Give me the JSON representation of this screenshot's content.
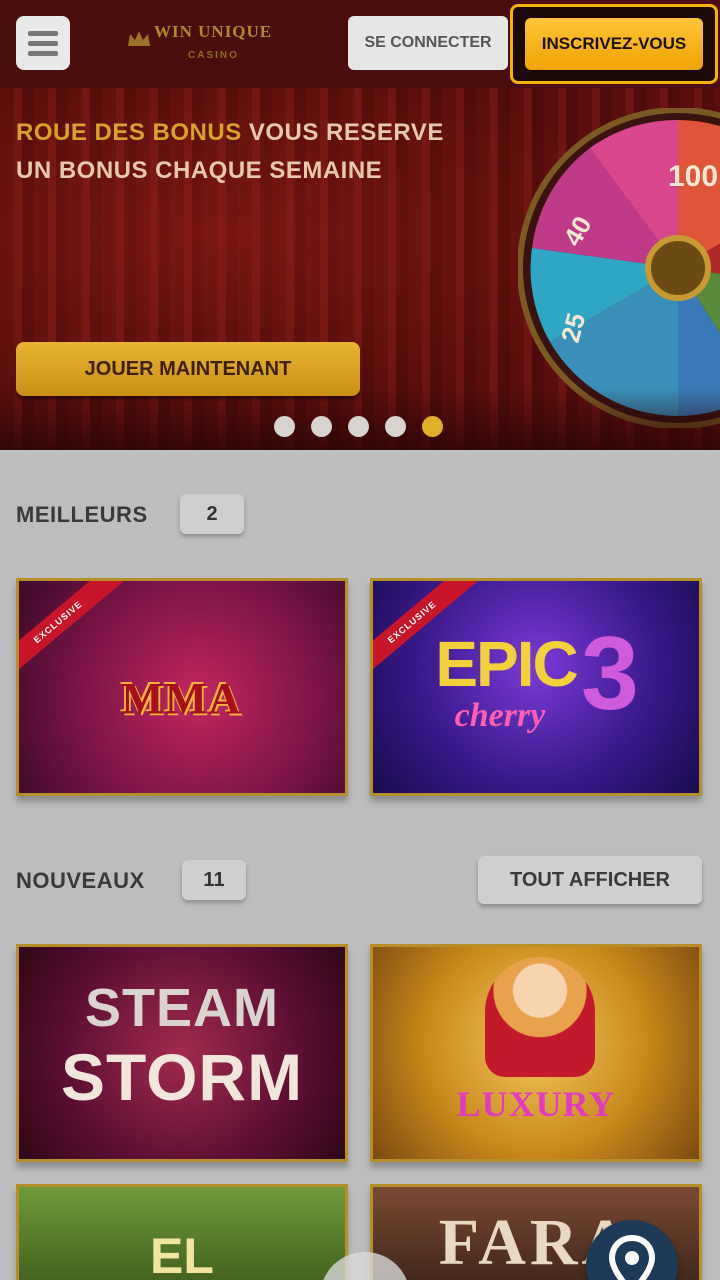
{
  "header": {
    "logo_text": "WIN UNIQUE",
    "logo_sub": "CASINO",
    "login_label": "SE CONNECTER",
    "signup_label": "INSCRIVEZ-VOUS"
  },
  "banner": {
    "promo_highlight": "ROUE DES BONUS",
    "promo_line1_rest": " VOUS RESERVE",
    "promo_line2": "UN BONUS CHAQUE SEMAINE",
    "cta_label": "JOUER MAINTENANT",
    "wheel_labels": [
      "100",
      "40",
      "25"
    ],
    "slides_total": 5,
    "slide_active": 5
  },
  "best": {
    "title": "MEILLEURS",
    "count": "2",
    "games": [
      {
        "title": "MMA",
        "ribbon": "EXCLUSIVE"
      },
      {
        "title_line1": "EPIC",
        "title_line2": "cherry",
        "title_num": "3",
        "ribbon": "EXCLUSIVE"
      }
    ]
  },
  "new": {
    "title": "NOUVEAUX",
    "count": "11",
    "show_all_label": "TOUT AFFICHER",
    "games": [
      {
        "title_line1": "STEAM",
        "title_line2": "STORM"
      },
      {
        "title": "LUXURY"
      },
      {
        "title": "EL"
      },
      {
        "title": "FARA"
      }
    ]
  },
  "colors": {
    "accent_gold": "#f0a400",
    "header_bg": "#4a0e0c",
    "page_bg": "#bdbdbd",
    "card_border": "#b78f2a"
  },
  "icons": [
    "menu-icon",
    "crown-logo-icon",
    "location-pin-icon"
  ]
}
